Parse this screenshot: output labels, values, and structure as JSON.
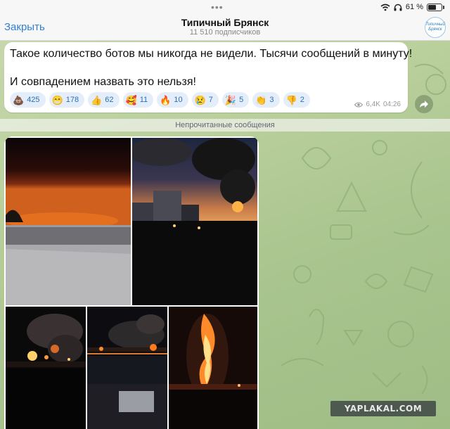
{
  "status_bar": {
    "battery_percent": "61 %",
    "battery_level": 0.61
  },
  "header": {
    "close_label": "Закрыть",
    "title": "Типичный Брянск",
    "subscribers": "11 510 подписчиков",
    "avatar_text": "Типичный Брянск"
  },
  "message": {
    "line1": "Такое количество ботов мы никогда не видели. Тысячи сообщений в минуту!",
    "line2": "И совпадением назвать это нельзя!",
    "views": "6,4K",
    "time": "04:26",
    "reactions": [
      {
        "emoji": "💩",
        "count": "425"
      },
      {
        "emoji": "😁",
        "count": "178"
      },
      {
        "emoji": "👍",
        "count": "62"
      },
      {
        "emoji": "🥰",
        "count": "11"
      },
      {
        "emoji": "🔥",
        "count": "10"
      },
      {
        "emoji": "😢",
        "count": "7"
      },
      {
        "emoji": "🎉",
        "count": "5"
      },
      {
        "emoji": "👏",
        "count": "3"
      },
      {
        "emoji": "👎",
        "count": "2"
      }
    ]
  },
  "divider": {
    "label": "Непрочитанные сообщения"
  },
  "watermark": {
    "text": "YAPLAKAL.COM"
  },
  "icons": {
    "wifi": "wifi-icon",
    "headphones": "headphones-icon",
    "eye": "eye-icon",
    "share": "share-arrow-icon"
  }
}
